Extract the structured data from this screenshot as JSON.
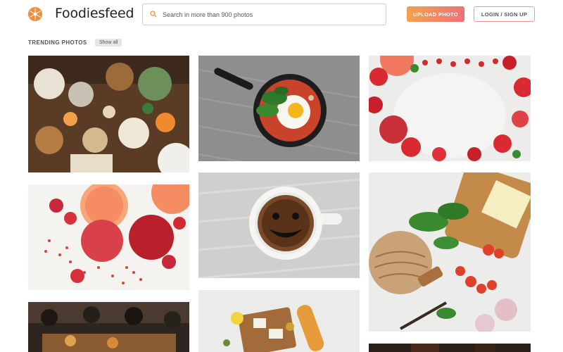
{
  "header": {
    "brand": "Foodiesfeed",
    "search_placeholder": "Search in more than 900 photos",
    "upload_label": "UPLOAD PHOTO",
    "login_label": "LOGIN / SIGN UP"
  },
  "section": {
    "title": "TRENDING PHOTOS",
    "show_all_label": "Show all"
  },
  "colors": {
    "accent_orange": "#f4a14b",
    "accent_pink": "#f0707a"
  },
  "photos": [
    {
      "subject": "overhead dinner table"
    },
    {
      "subject": "egg and spinach in cast iron pan"
    },
    {
      "subject": "red fruits and vegetables frame"
    },
    {
      "subject": "apples, grapefruit and goji berries"
    },
    {
      "subject": "cup of black coffee"
    },
    {
      "subject": "sourdough bread and vegetables"
    },
    {
      "subject": "people serving food"
    },
    {
      "subject": "cheese board with baguette"
    },
    {
      "subject": "dark food photo"
    }
  ]
}
